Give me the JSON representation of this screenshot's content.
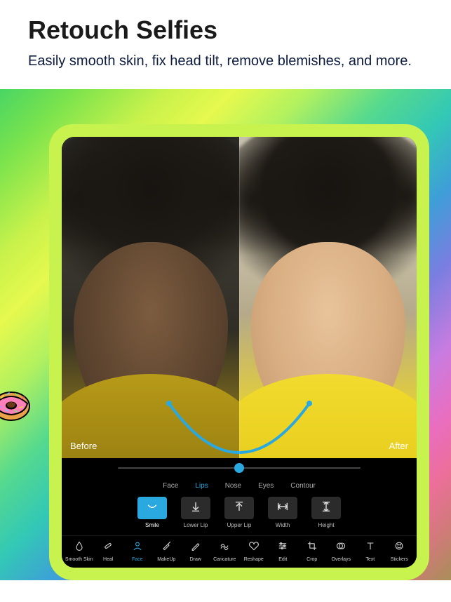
{
  "header": {
    "title": "Retouch Selfies",
    "subtitle": "Easily smooth skin, fix head tilt, remove blemishes, and more."
  },
  "compare": {
    "before_label": "Before",
    "after_label": "After"
  },
  "subtabs": [
    {
      "label": "Face",
      "active": false
    },
    {
      "label": "Lips",
      "active": true
    },
    {
      "label": "Nose",
      "active": false
    },
    {
      "label": "Eyes",
      "active": false
    },
    {
      "label": "Contour",
      "active": false
    }
  ],
  "tools": [
    {
      "label": "Smile",
      "icon": "smile-icon",
      "active": true
    },
    {
      "label": "Lower Lip",
      "icon": "arrow-down-icon",
      "active": false
    },
    {
      "label": "Upper Lip",
      "icon": "arrow-up-icon",
      "active": false
    },
    {
      "label": "Width",
      "icon": "width-icon",
      "active": false
    },
    {
      "label": "Height",
      "icon": "height-icon",
      "active": false
    }
  ],
  "bottombar": [
    {
      "label": "Smooth Skin",
      "icon": "drop-icon",
      "active": false
    },
    {
      "label": "Heal",
      "icon": "bandage-icon",
      "active": false
    },
    {
      "label": "Face",
      "icon": "person-icon",
      "active": true
    },
    {
      "label": "MakeUp",
      "icon": "brush-icon",
      "active": false
    },
    {
      "label": "Draw",
      "icon": "pencil-icon",
      "active": false
    },
    {
      "label": "Caricature",
      "icon": "warp-icon",
      "active": false
    },
    {
      "label": "Reshape",
      "icon": "heart-icon",
      "active": false
    },
    {
      "label": "Edit",
      "icon": "sliders-icon",
      "active": false
    },
    {
      "label": "Crop",
      "icon": "crop-icon",
      "active": false
    },
    {
      "label": "Overlays",
      "icon": "overlays-icon",
      "active": false
    },
    {
      "label": "Text",
      "icon": "text-icon",
      "active": false
    },
    {
      "label": "Stickers",
      "icon": "sticker-icon",
      "active": false
    }
  ],
  "slider": {
    "value": 50,
    "min": 0,
    "max": 100
  },
  "colors": {
    "accent": "#2aa8e0"
  }
}
